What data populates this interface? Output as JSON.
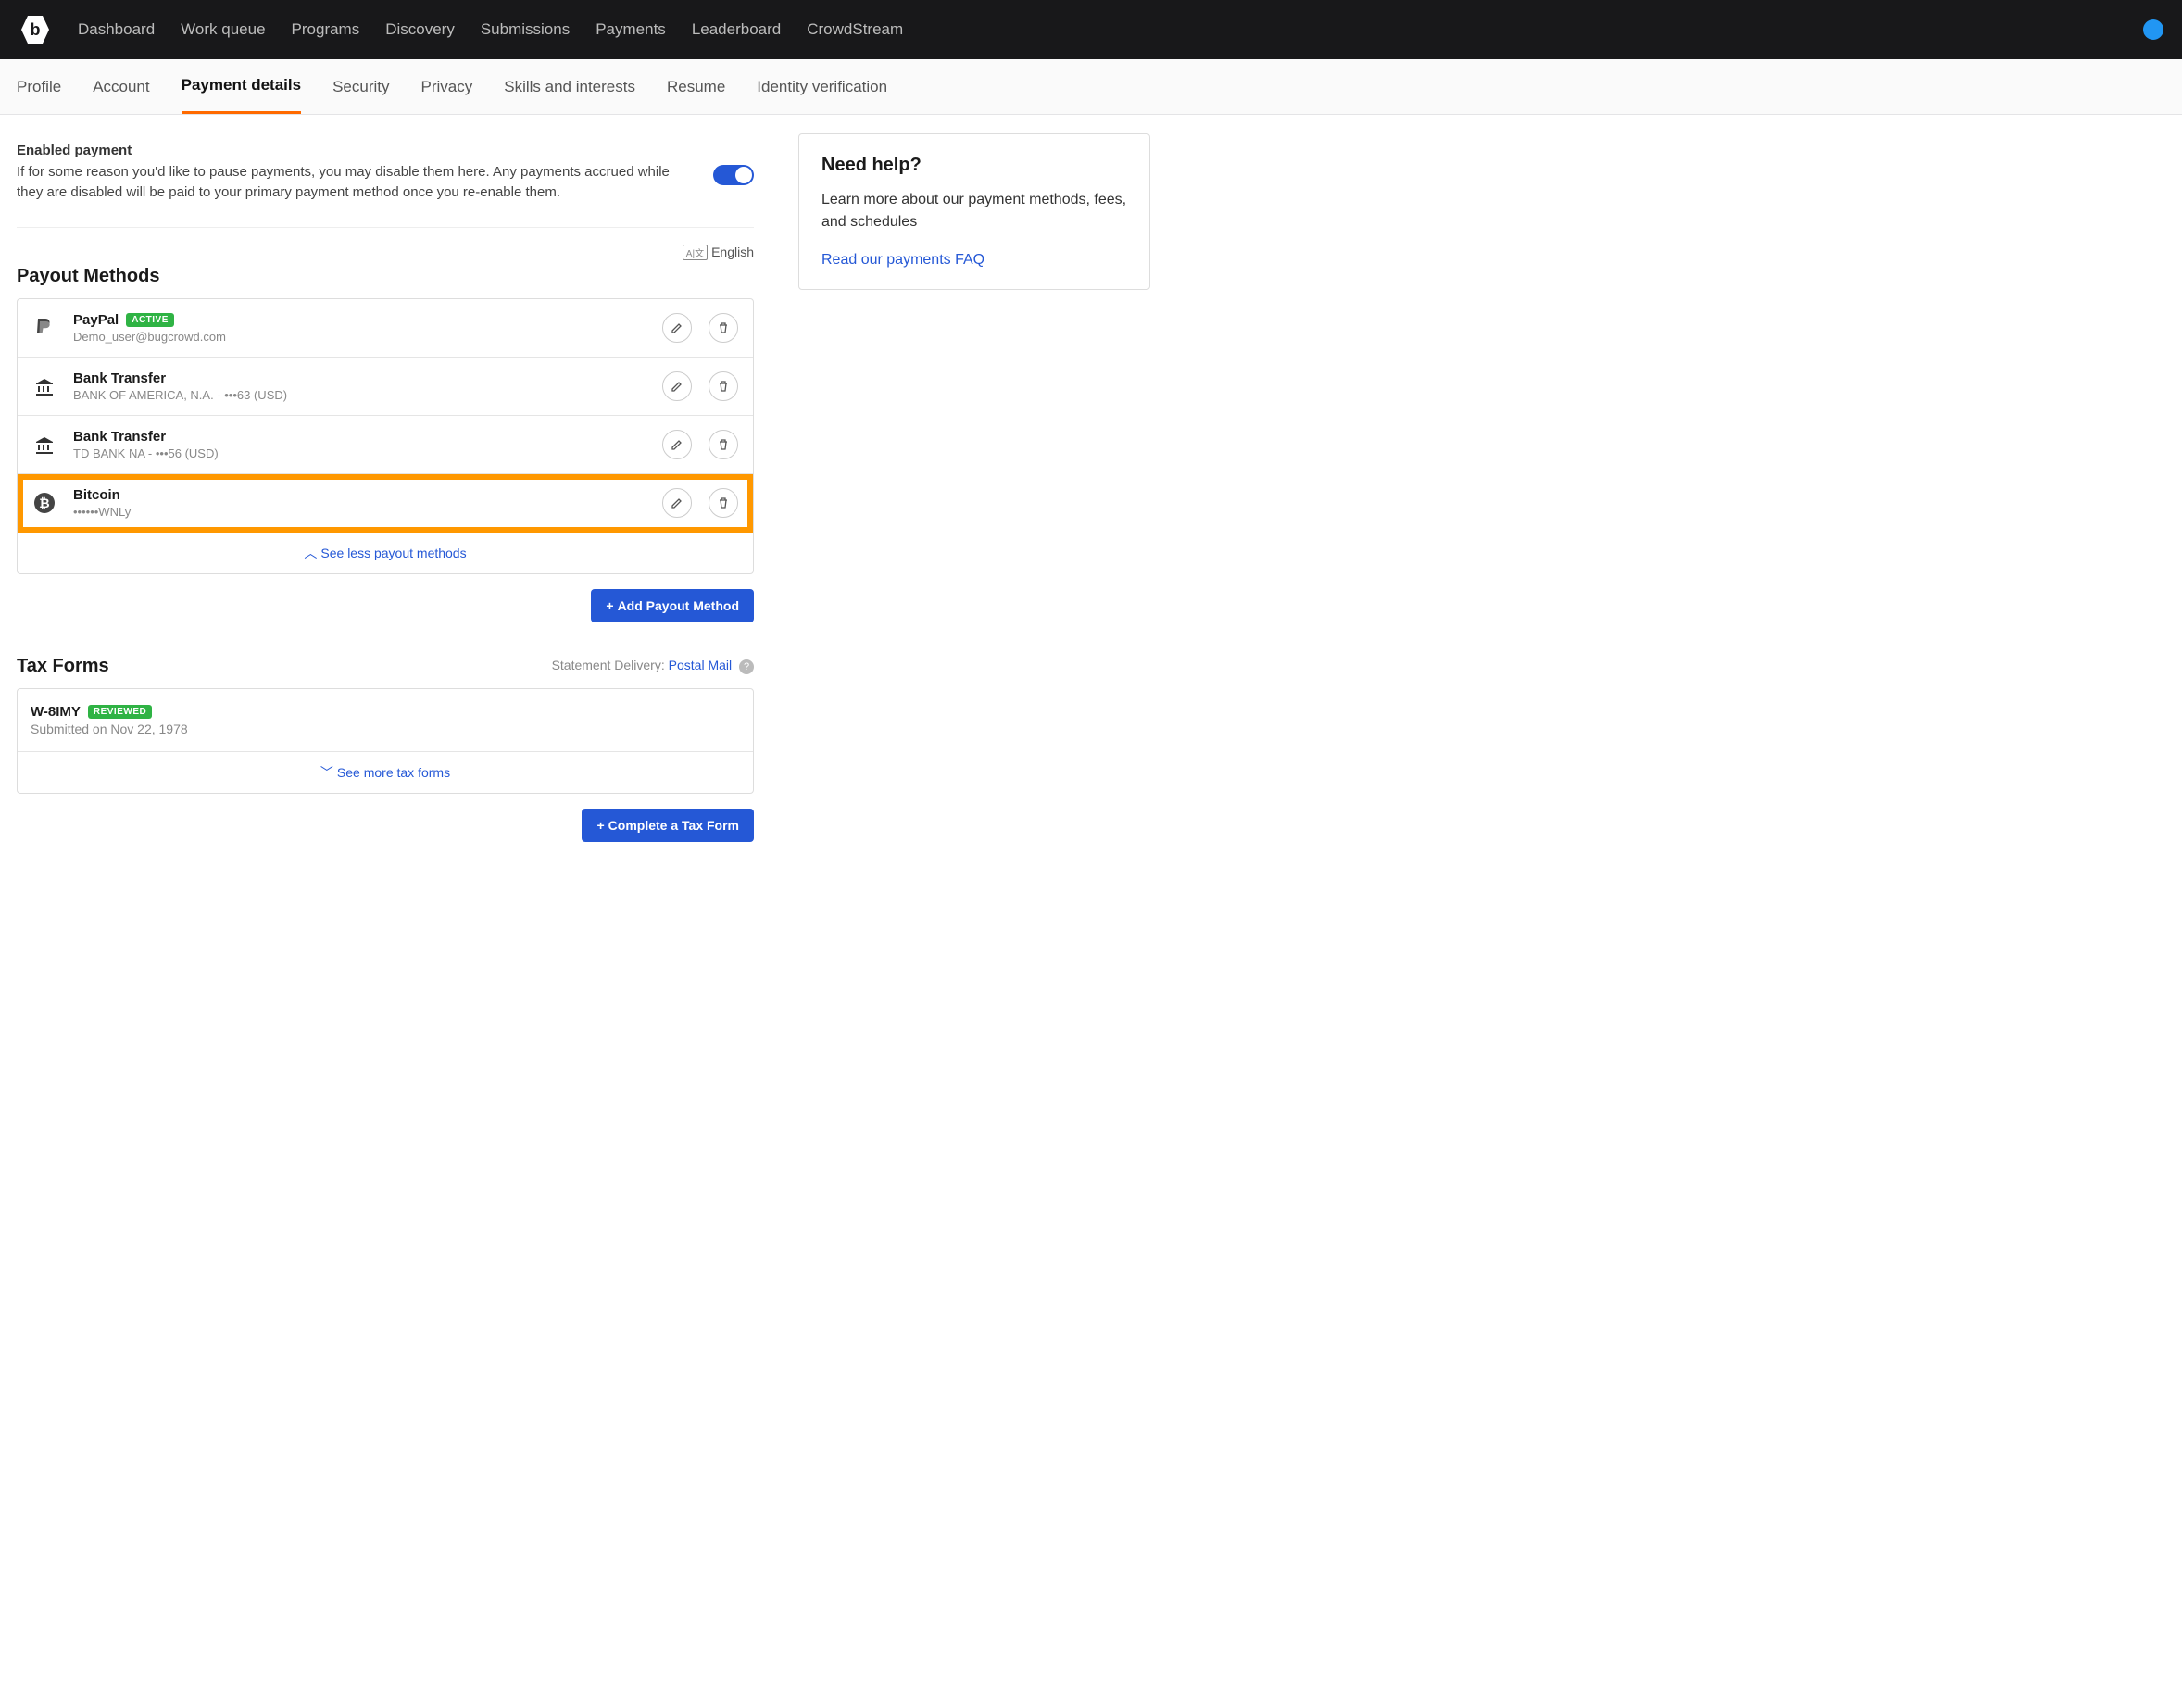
{
  "topnav": {
    "items": [
      "Dashboard",
      "Work queue",
      "Programs",
      "Discovery",
      "Submissions",
      "Payments",
      "Leaderboard",
      "CrowdStream"
    ]
  },
  "subnav": {
    "tabs": [
      "Profile",
      "Account",
      "Payment details",
      "Security",
      "Privacy",
      "Skills and interests",
      "Resume",
      "Identity verification"
    ],
    "active_index": 2
  },
  "enabled": {
    "title": "Enabled payment",
    "desc": "If for some reason you'd like to pause payments, you may disable them here. Any payments accrued while they are disabled will be paid to your primary payment method once you re-enable them."
  },
  "language_label": "English",
  "payout": {
    "heading": "Payout Methods",
    "methods": [
      {
        "title": "PayPal",
        "sub": "Demo_user@bugcrowd.com",
        "badge": "ACTIVE",
        "icon": "paypal"
      },
      {
        "title": "Bank Transfer",
        "sub": "BANK OF AMERICA, N.A. - •••63 (USD)",
        "icon": "bank"
      },
      {
        "title": "Bank Transfer",
        "sub": "TD BANK NA - •••56 (USD)",
        "icon": "bank"
      },
      {
        "title": "Bitcoin",
        "sub": "••••••WNLy",
        "icon": "bitcoin",
        "highlight": true
      }
    ],
    "see_less": "See less payout methods",
    "add_btn": "Add Payout Method"
  },
  "tax": {
    "heading": "Tax Forms",
    "statement_label": "Statement Delivery:",
    "statement_value": "Postal Mail",
    "forms": [
      {
        "title": "W-8IMY",
        "badge": "REVIEWED",
        "sub": "Submitted on Nov 22, 1978"
      }
    ],
    "see_more": "See more tax forms",
    "complete_btn": "Complete a Tax Form"
  },
  "help": {
    "title": "Need help?",
    "body": "Learn more about our payment methods, fees, and schedules",
    "link": "Read our payments FAQ"
  }
}
